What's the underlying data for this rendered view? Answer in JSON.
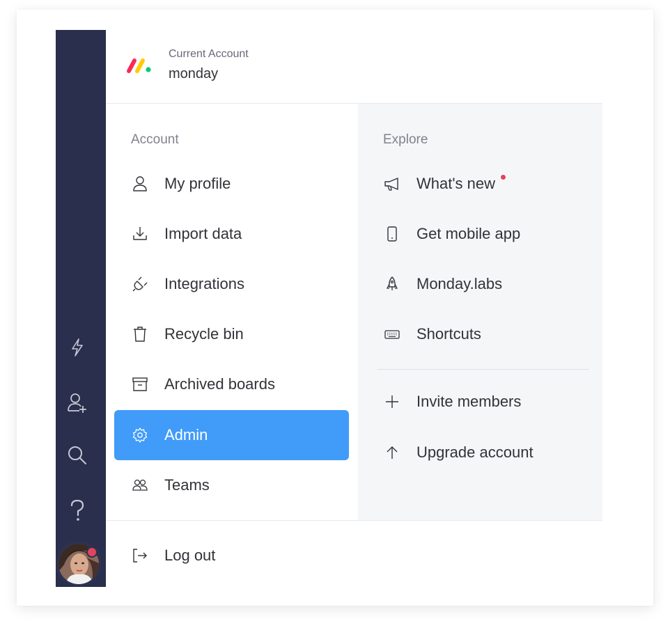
{
  "header": {
    "label": "Current Account",
    "account_name": "monday",
    "logo_colors": [
      "#f62b54",
      "#ffcb00",
      "#00ca72"
    ]
  },
  "rail": {
    "icons": [
      "lightning-icon",
      "add-user-icon",
      "search-icon",
      "help-icon"
    ],
    "avatar_badge_color": "#e2445c"
  },
  "account": {
    "title": "Account",
    "items": [
      {
        "label": "My profile",
        "icon": "person-icon"
      },
      {
        "label": "Import data",
        "icon": "import-icon"
      },
      {
        "label": "Integrations",
        "icon": "plug-icon"
      },
      {
        "label": "Recycle bin",
        "icon": "trash-icon"
      },
      {
        "label": "Archived boards",
        "icon": "archive-icon"
      },
      {
        "label": "Admin",
        "icon": "gear-icon",
        "selected": true
      },
      {
        "label": "Teams",
        "icon": "team-icon"
      }
    ]
  },
  "explore": {
    "title": "Explore",
    "items": [
      {
        "label": "What's new",
        "icon": "megaphone-icon",
        "has_dot": true
      },
      {
        "label": "Get mobile app",
        "icon": "mobile-icon"
      },
      {
        "label": "Monday.labs",
        "icon": "rocket-icon"
      },
      {
        "label": "Shortcuts",
        "icon": "keyboard-icon"
      }
    ],
    "actions": [
      {
        "label": "Invite members",
        "icon": "plus-icon"
      },
      {
        "label": "Upgrade account",
        "icon": "arrow-up-icon"
      }
    ]
  },
  "footer": {
    "logout_label": "Log out",
    "logout_icon": "logout-icon"
  },
  "colors": {
    "selected": "#419bf9",
    "rail": "#292f4c",
    "explore_bg": "#f5f6f8",
    "notification": "#e2445c"
  }
}
